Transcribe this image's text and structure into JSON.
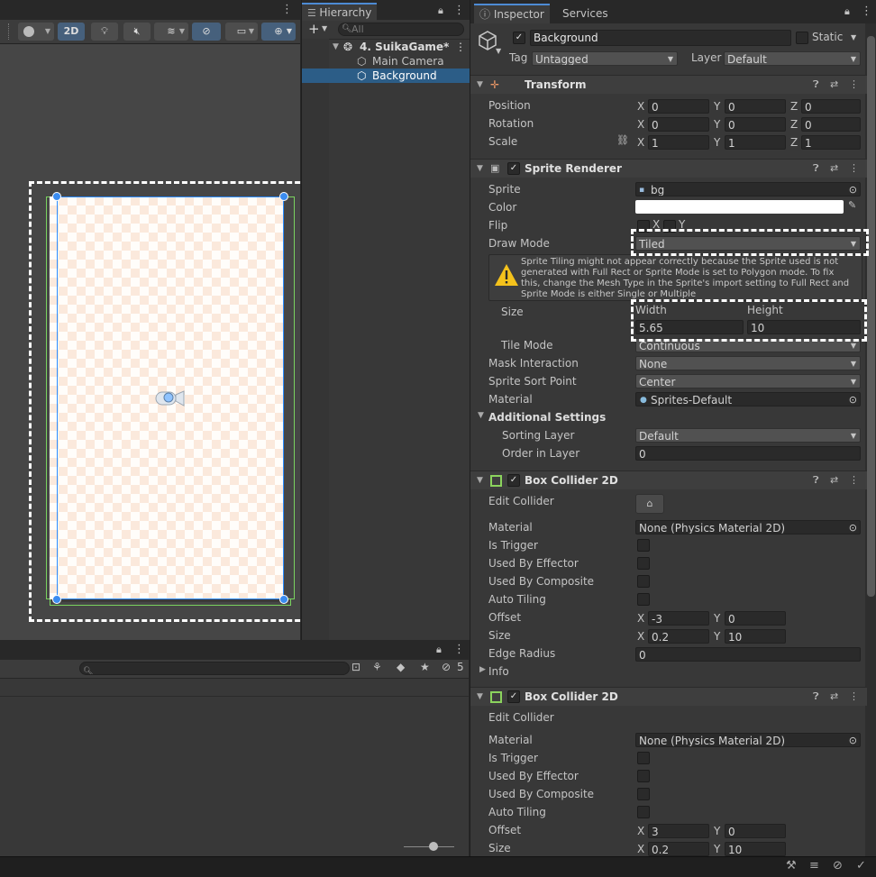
{
  "scene": {
    "toolbar": {
      "btn_2d": "2D"
    }
  },
  "hierarchy": {
    "tab_label": "Hierarchy",
    "search_placeholder": "All",
    "scene_name": "4. SuikaGame*",
    "items": [
      {
        "label": "Main Camera"
      },
      {
        "label": "Background"
      }
    ]
  },
  "inspector": {
    "tabs": [
      "Inspector",
      "Services"
    ],
    "object": {
      "name": "Background",
      "static_label": "Static",
      "tag_label": "Tag",
      "tag_value": "Untagged",
      "layer_label": "Layer",
      "layer_value": "Default"
    },
    "transform": {
      "title": "Transform",
      "rows": [
        {
          "label": "Position",
          "x": "0",
          "y": "0",
          "z": "0"
        },
        {
          "label": "Rotation",
          "x": "0",
          "y": "0",
          "z": "0"
        },
        {
          "label": "Scale",
          "x": "1",
          "y": "1",
          "z": "1"
        }
      ]
    },
    "sprite_renderer": {
      "title": "Sprite Renderer",
      "sprite_label": "Sprite",
      "sprite_value": "bg",
      "color_label": "Color",
      "flip_label": "Flip",
      "flip_x": "X",
      "flip_y": "Y",
      "draw_mode_label": "Draw Mode",
      "draw_mode_value": "Tiled",
      "warning": "Sprite Tiling might not appear correctly because the Sprite used is not generated with Full Rect or Sprite Mode is set to Polygon mode. To fix this, change the Mesh Type in the Sprite's import setting to Full Rect and Sprite Mode is either Single or Multiple",
      "size_label": "Size",
      "width_label": "Width",
      "height_label": "Height",
      "width_value": "5.65",
      "height_value": "10",
      "tile_mode_label": "Tile Mode",
      "tile_mode_value": "Continuous",
      "mask_label": "Mask Interaction",
      "mask_value": "None",
      "sort_point_label": "Sprite Sort Point",
      "sort_point_value": "Center",
      "material_label": "Material",
      "material_value": "Sprites-Default",
      "additional_label": "Additional Settings",
      "sorting_layer_label": "Sorting Layer",
      "sorting_layer_value": "Default",
      "order_label": "Order in Layer",
      "order_value": "0"
    },
    "box_collider_1": {
      "title": "Box Collider 2D",
      "edit_label": "Edit Collider",
      "material_label": "Material",
      "material_value": "None (Physics Material 2D)",
      "is_trigger": "Is Trigger",
      "used_by_effector": "Used By Effector",
      "used_by_composite": "Used By Composite",
      "auto_tiling": "Auto Tiling",
      "offset_label": "Offset",
      "offset_x": "-3",
      "offset_y": "0",
      "size_label": "Size",
      "size_x": "0.2",
      "size_y": "10",
      "edge_label": "Edge Radius",
      "edge_value": "0",
      "info_label": "Info"
    },
    "box_collider_2": {
      "title": "Box Collider 2D",
      "edit_label": "Edit Collider",
      "material_label": "Material",
      "material_value": "None (Physics Material 2D)",
      "is_trigger": "Is Trigger",
      "used_by_effector": "Used By Effector",
      "used_by_composite": "Used By Composite",
      "auto_tiling": "Auto Tiling",
      "offset_label": "Offset",
      "offset_x": "3",
      "offset_y": "0",
      "size_label": "Size",
      "size_x": "0.2",
      "size_y": "10"
    }
  },
  "project": {
    "hidden_count": "5"
  },
  "axis": {
    "x": "X",
    "y": "Y",
    "z": "Z"
  }
}
